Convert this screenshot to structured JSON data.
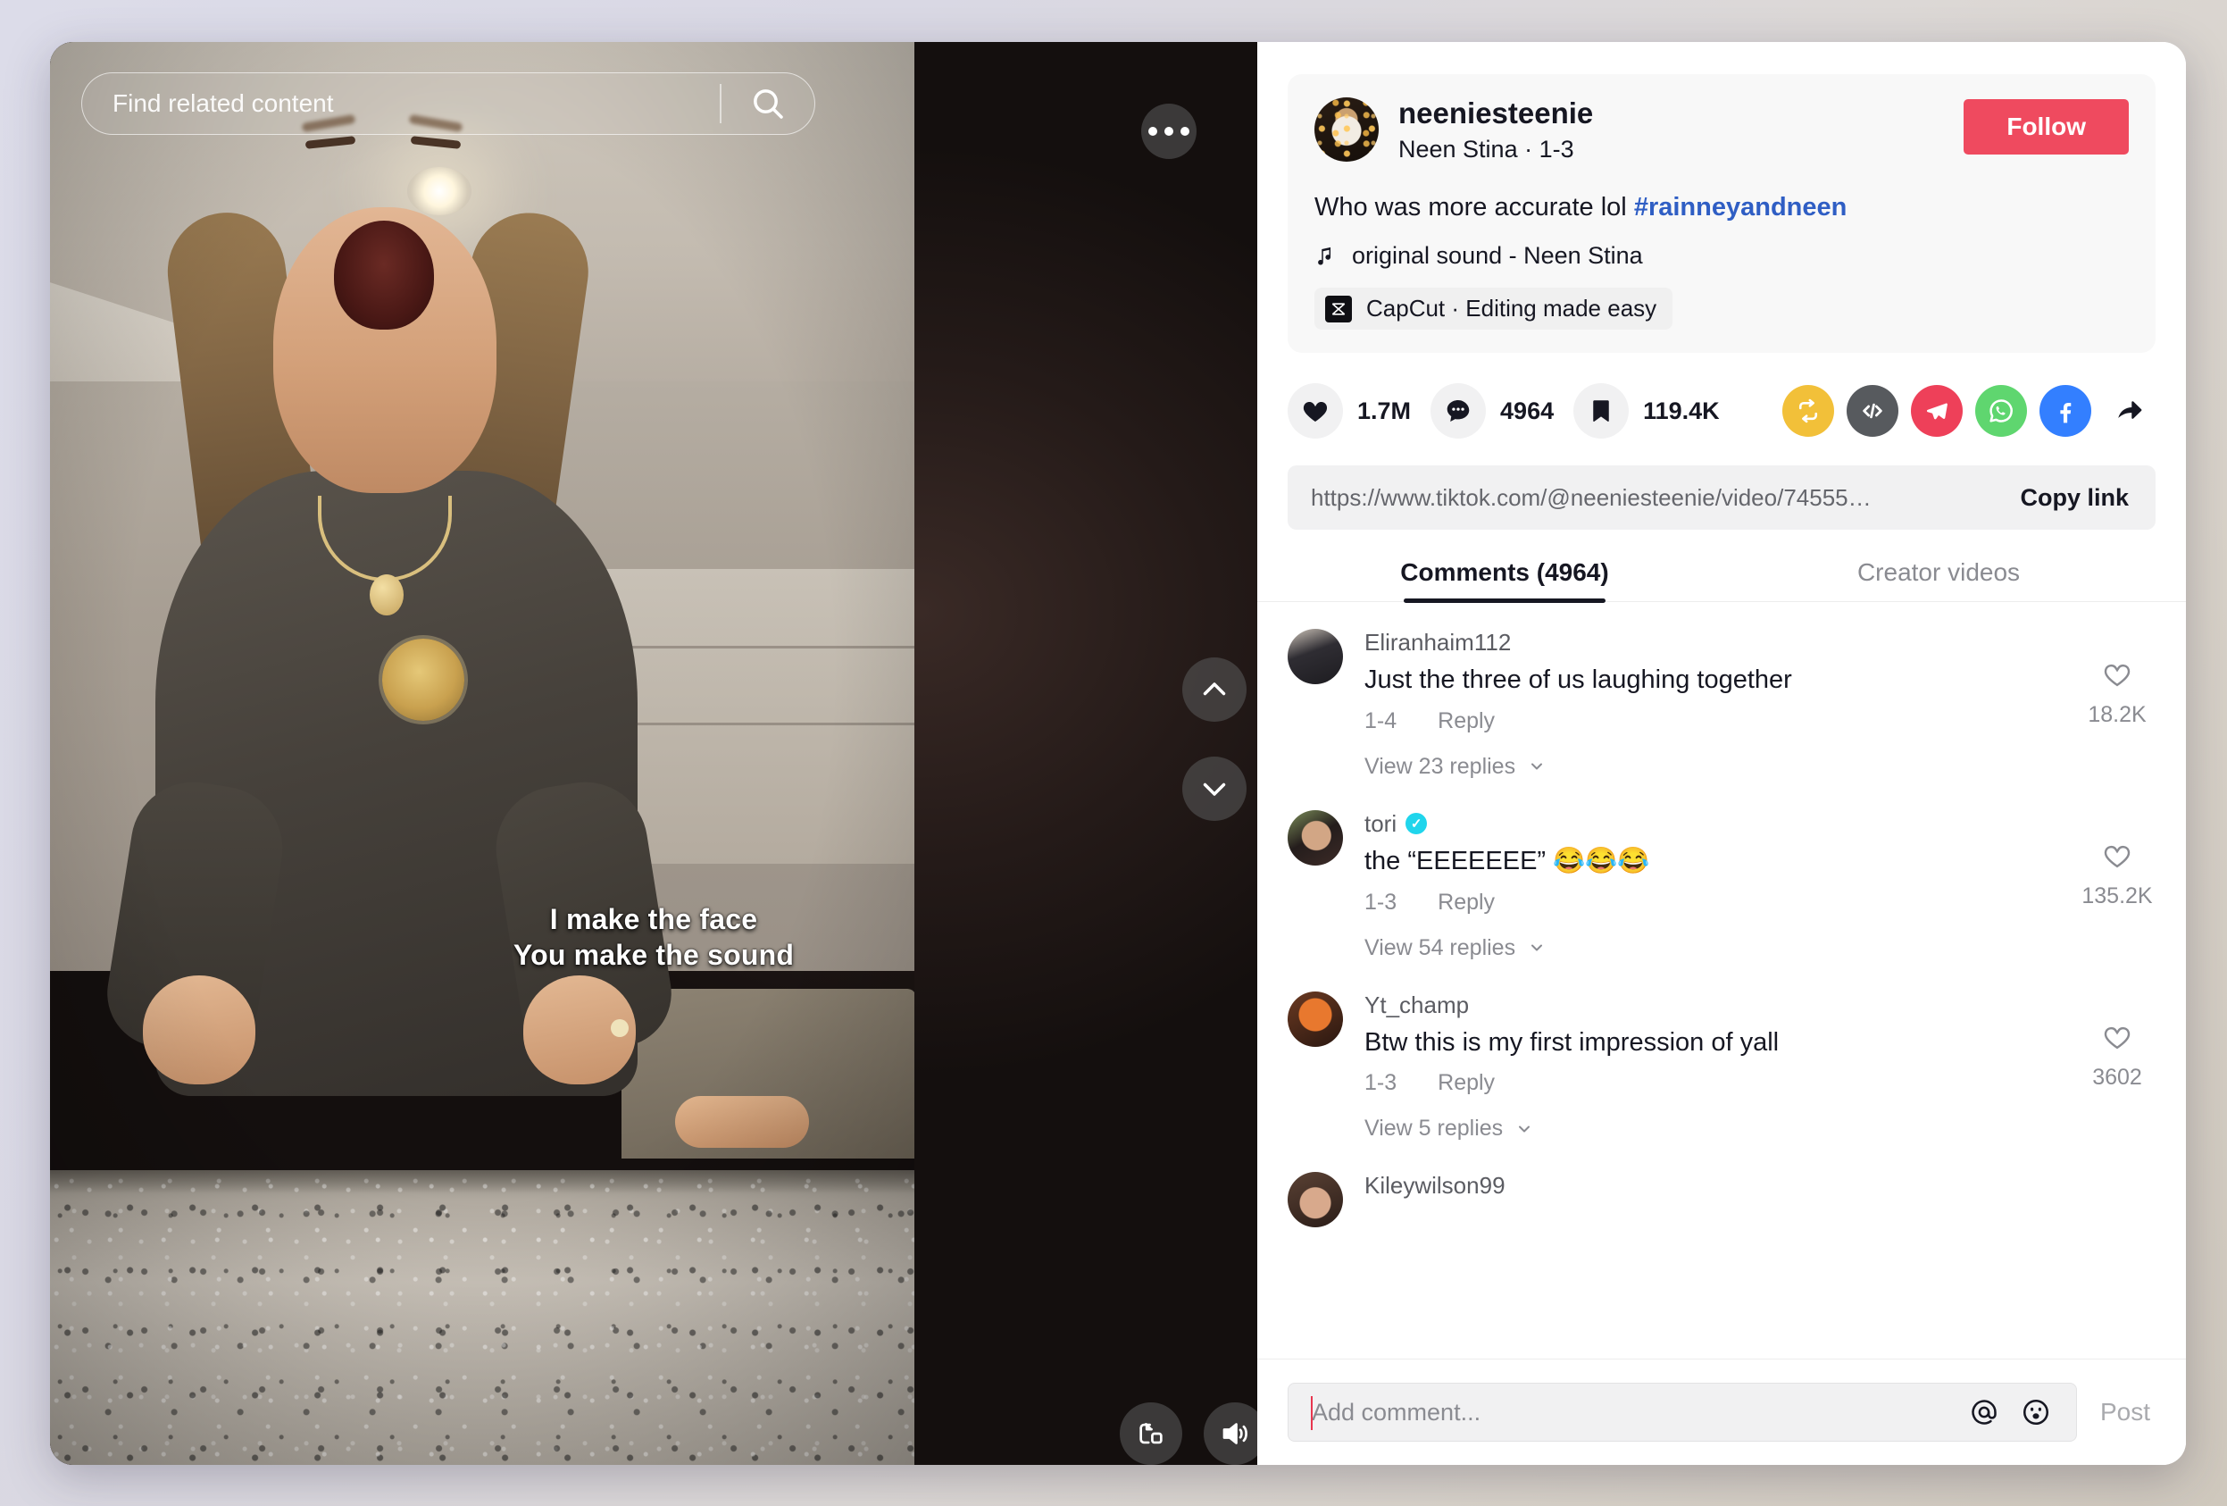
{
  "video": {
    "search_placeholder": "Find related content",
    "search_icon": "search-icon",
    "more_icon": "more-options-icon",
    "prev_icon": "chevron-up-icon",
    "next_icon": "chevron-down-icon",
    "pip_icon": "picture-in-picture-icon",
    "volume_icon": "volume-on-icon",
    "caption_line1": "I make the face",
    "caption_line2": "You make the sound"
  },
  "post": {
    "author_username": "neeniesteenie",
    "author_subtitle": "Neen Stina · 1-3",
    "follow_label": "Follow",
    "caption_text": "Who was more accurate lol ",
    "caption_hashtag": "#rainneyandneen",
    "sound_icon": "music-note-icon",
    "sound_label": "original sound - Neen Stina",
    "capcut_label": "CapCut · Editing made easy",
    "capcut_icon": "capcut-logo-icon"
  },
  "stats": {
    "like_icon": "heart-filled-icon",
    "like_count": "1.7M",
    "comment_icon": "comment-bubble-icon",
    "comment_count": "4964",
    "bookmark_icon": "bookmark-filled-icon",
    "bookmark_count": "119.4K"
  },
  "share": {
    "items": [
      {
        "name": "repost-icon",
        "color": "#f2c039"
      },
      {
        "name": "embed-icon",
        "color": "#575a5e"
      },
      {
        "name": "telegram-icon",
        "color": "#ee4059"
      },
      {
        "name": "whatsapp-icon",
        "color": "#5fd66f"
      },
      {
        "name": "facebook-icon",
        "color": "#337fff"
      },
      {
        "name": "share-arrow-icon",
        "color": "#161722"
      }
    ]
  },
  "link": {
    "url": "https://www.tiktok.com/@neeniesteenie/video/74555…",
    "copy_label": "Copy link"
  },
  "tabs": [
    {
      "label": "Comments (4964)",
      "active": true
    },
    {
      "label": "Creator videos",
      "active": false
    }
  ],
  "comments": [
    {
      "username": "Eliranhaim112",
      "verified": false,
      "text": "Just the three of us laughing together",
      "date": "1-4",
      "reply_label": "Reply",
      "like_count": "18.2K",
      "replies_label": "View 23 replies",
      "avatar_color": "#3b3a42"
    },
    {
      "username": "tori",
      "verified": true,
      "text": "the “EEEEEEE” 😂😂😂",
      "date": "1-3",
      "reply_label": "Reply",
      "like_count": "135.2K",
      "replies_label": "View 54 replies",
      "avatar_color": "#6d5a4c"
    },
    {
      "username": "Yt_champ",
      "verified": false,
      "text": "Btw this is my first impression of yall",
      "date": "1-3",
      "reply_label": "Reply",
      "like_count": "3602",
      "replies_label": "View 5 replies",
      "avatar_color": "#8a4322"
    },
    {
      "username": "Kileywilson99",
      "verified": false,
      "text": "",
      "date": "",
      "reply_label": "",
      "like_count": "",
      "replies_label": "",
      "avatar_color": "#5a4236"
    }
  ],
  "add_comment": {
    "placeholder": "Add comment...",
    "mention_icon": "at-mention-icon",
    "emoji_icon": "emoji-icon",
    "post_label": "Post"
  }
}
